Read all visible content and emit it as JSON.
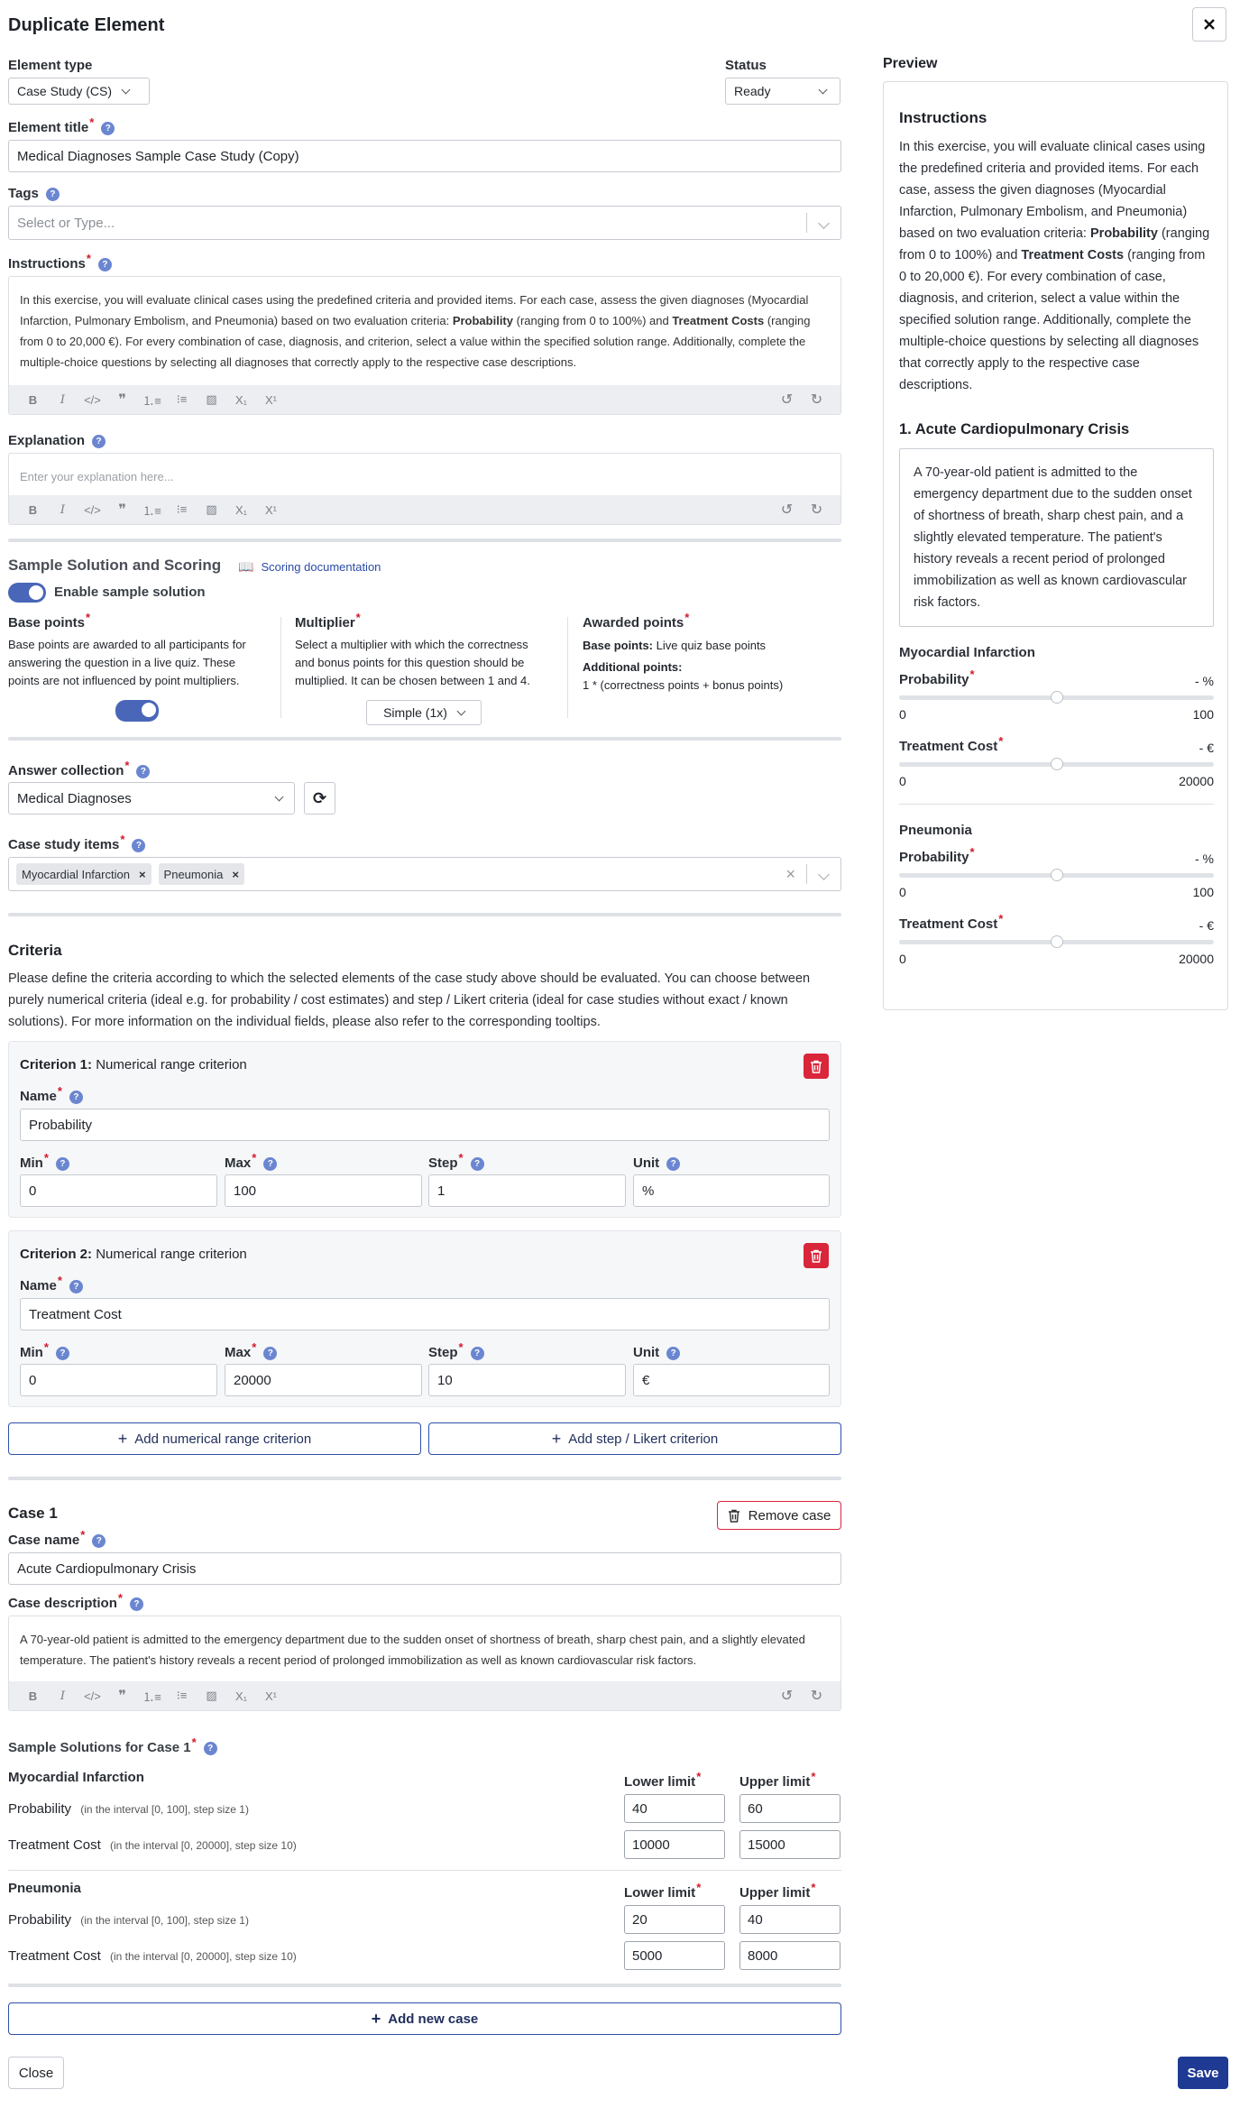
{
  "dialog": {
    "title": "Duplicate Element"
  },
  "element_type": {
    "label": "Element type",
    "value": "Case Study (CS)"
  },
  "status": {
    "label": "Status",
    "value": "Ready"
  },
  "element_title": {
    "label": "Element title",
    "value": "Medical Diagnoses Sample Case Study (Copy)"
  },
  "tags": {
    "label": "Tags",
    "placeholder": "Select or Type..."
  },
  "instructions": {
    "label": "Instructions",
    "text_1": "In this exercise, you will evaluate clinical cases using the predefined criteria and provided items. For each case, assess the given diagnoses (Myocardial Infarction, Pulmonary Embolism, and Pneumonia) based on two evaluation criteria: ",
    "bold_1": "Probability",
    "text_2": " (ranging from 0 to 100%) and ",
    "bold_2": "Treatment Costs",
    "text_3": " (ranging from 0 to 20,000 €). For every combination of case, diagnosis, and criterion, select a value within the specified solution range. Additionally, complete the multiple-choice questions by selecting all diagnoses that correctly apply to the respective case descriptions."
  },
  "explanation": {
    "label": "Explanation",
    "placeholder": "Enter your explanation here..."
  },
  "scoring": {
    "title": "Sample Solution and Scoring",
    "doc_link": "Scoring documentation",
    "enable_label": "Enable sample solution",
    "base_points_label": "Base points",
    "base_points_desc": "Base points are awarded to all participants for answering the question in a live quiz. These points are not influenced by point multipliers.",
    "multiplier_label": "Multiplier",
    "multiplier_desc": "Select a multiplier with which the correctness and bonus points for this question should be multiplied. It can be chosen between 1 and 4.",
    "multiplier_value": "Simple (1x)",
    "awarded_label": "Awarded points",
    "awarded_base_key": "Base points:",
    "awarded_base_val": "Live quiz base points",
    "awarded_additional_key": "Additional points:",
    "awarded_formula": "1 * (correctness points + bonus points)"
  },
  "answer_collection": {
    "label": "Answer collection",
    "value": "Medical Diagnoses"
  },
  "case_study_items": {
    "label": "Case study items",
    "items": [
      "Myocardial Infarction",
      "Pneumonia"
    ]
  },
  "criteria": {
    "title": "Criteria",
    "description": "Please define the criteria according to which the selected elements of the case study above should be evaluated. You can choose between purely numerical criteria (ideal e.g. for probability / cost estimates) and step / Likert criteria (ideal for case studies without exact / known solutions). For more information on the individual fields, please also refer to the corresponding tooltips.",
    "name_label": "Name",
    "min_label": "Min",
    "max_label": "Max",
    "step_label": "Step",
    "unit_label": "Unit",
    "list": [
      {
        "heading": "Criterion 1:",
        "type": "Numerical range criterion",
        "name": "Probability",
        "min": "0",
        "max": "100",
        "step": "1",
        "unit": "%"
      },
      {
        "heading": "Criterion 2:",
        "type": "Numerical range criterion",
        "name": "Treatment Cost",
        "min": "0",
        "max": "20000",
        "step": "10",
        "unit": "€"
      }
    ],
    "add_numerical": "Add numerical range criterion",
    "add_likert": "Add step / Likert criterion"
  },
  "case1": {
    "title": "Case 1",
    "remove_label": "Remove case",
    "name_label": "Case name",
    "name_value": "Acute Cardiopulmonary Crisis",
    "desc_label": "Case description",
    "desc_value": "A 70-year-old patient is admitted to the emergency department due to the sudden onset of shortness of breath, sharp chest pain, and a slightly elevated temperature. The patient's history reveals a recent period of prolonged immobilization as well as known cardiovascular risk factors.",
    "solutions_label": "Sample Solutions for Case 1",
    "lower_label": "Lower limit",
    "upper_label": "Upper limit",
    "groups": [
      {
        "item": "Myocardial Infarction",
        "rows": [
          {
            "name": "Probability",
            "hint": "(in the interval [0, 100], step size 1)",
            "lower": "40",
            "upper": "60"
          },
          {
            "name": "Treatment Cost",
            "hint": "(in the interval [0, 20000], step size 10)",
            "lower": "10000",
            "upper": "15000"
          }
        ]
      },
      {
        "item": "Pneumonia",
        "rows": [
          {
            "name": "Probability",
            "hint": "(in the interval [0, 100], step size 1)",
            "lower": "20",
            "upper": "40"
          },
          {
            "name": "Treatment Cost",
            "hint": "(in the interval [0, 20000], step size 10)",
            "lower": "5000",
            "upper": "8000"
          }
        ]
      }
    ]
  },
  "add_case": "Add new case",
  "footer": {
    "close": "Close",
    "save": "Save"
  },
  "preview": {
    "title": "Preview",
    "instructions_title": "Instructions",
    "case_title": "1. Acute Cardiopulmonary Crisis",
    "items": [
      {
        "name": "Myocardial Infarction",
        "criteria": [
          {
            "name": "Probability",
            "value": "- %",
            "min": "0",
            "max": "100",
            "level": 0.5
          },
          {
            "name": "Treatment Cost",
            "value": "- €",
            "min": "0",
            "max": "20000",
            "level": 0.5
          }
        ]
      },
      {
        "name": "Pneumonia",
        "criteria": [
          {
            "name": "Probability",
            "value": "- %",
            "min": "0",
            "max": "100",
            "level": 0.5
          },
          {
            "name": "Treatment Cost",
            "value": "- €",
            "min": "0",
            "max": "20000",
            "level": 0.5
          }
        ]
      }
    ]
  },
  "colors": {
    "primary": "#1f3a93",
    "danger": "#d9263a",
    "toggle": "#4a66b8"
  }
}
